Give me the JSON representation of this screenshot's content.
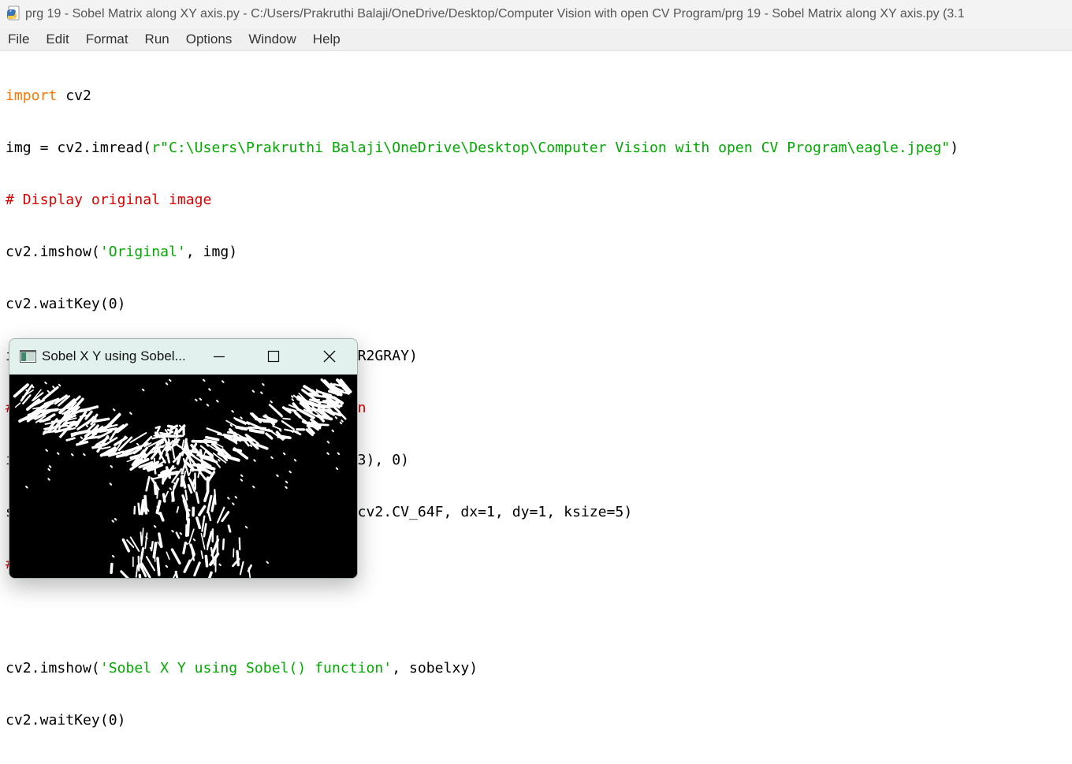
{
  "window": {
    "title": "prg 19 - Sobel Matrix along XY axis.py - C:/Users/Prakruthi Balaji/OneDrive/Desktop/Computer Vision with open CV Program/prg 19 - Sobel Matrix along XY axis.py (3.1"
  },
  "menu": {
    "file": "File",
    "edit": "Edit",
    "format": "Format",
    "run": "Run",
    "options": "Options",
    "window": "Window",
    "help": "Help"
  },
  "code": {
    "line1": [
      {
        "t": "import",
        "c": "kw"
      },
      {
        "t": " cv2",
        "c": "plain"
      }
    ],
    "line2": [
      {
        "t": "img = cv2.imread(",
        "c": "plain"
      },
      {
        "t": "r\"C:\\Users\\Prakruthi Balaji\\OneDrive\\Desktop\\Computer Vision with open CV Program\\eagle.jpeg\"",
        "c": "str"
      },
      {
        "t": ")",
        "c": "plain"
      }
    ],
    "line3": [
      {
        "t": "# Display original image",
        "c": "com"
      }
    ],
    "line4": [
      {
        "t": "cv2.imshow(",
        "c": "plain"
      },
      {
        "t": "'Original'",
        "c": "str"
      },
      {
        "t": ", img)",
        "c": "plain"
      }
    ],
    "line5": [
      {
        "t": "cv2.waitKey(0)",
        "c": "plain"
      }
    ],
    "line6": [
      {
        "t": "img_gray = cv2.cvtColor(img, cv2.COLOR_BGR2GRAY)",
        "c": "plain"
      }
    ],
    "line7": [
      {
        "t": "# Blur the image for better edge detection",
        "c": "com"
      }
    ],
    "line8": [
      {
        "t": "img_blur = cv2.GaussianBlur(img_gray, (3,3), 0)",
        "c": "plain"
      }
    ],
    "line9": [
      {
        "t": "sobelxy = cv2.Sobel(src=img_blur, ddepth=cv2.CV_64F, dx=1, dy=1, ksize=5)",
        "c": "plain"
      }
    ],
    "line10": [
      {
        "t": "# Combined X and Y Sobel Edge Detection",
        "c": "com"
      }
    ],
    "line11": [],
    "line12": [
      {
        "t": "cv2.imshow(",
        "c": "plain"
      },
      {
        "t": "'Sobel X Y using Sobel() function'",
        "c": "str"
      },
      {
        "t": ", sobelxy)",
        "c": "plain"
      }
    ],
    "line13": [
      {
        "t": "cv2.waitKey(0)",
        "c": "plain"
      }
    ]
  },
  "cv_window": {
    "title": "Sobel X Y using Sobel...",
    "minimize_icon": "minimize-icon",
    "maximize_icon": "maximize-icon",
    "close_icon": "close-icon"
  },
  "colors": {
    "keyword": "#ff7700",
    "string": "#00aa00",
    "comment": "#dd0000",
    "cv_titlebar": "#e2f1ee"
  }
}
